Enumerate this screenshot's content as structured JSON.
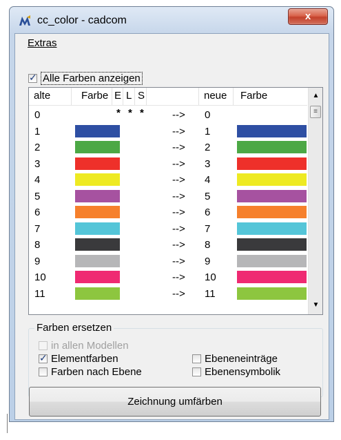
{
  "window": {
    "title": "cc_color - cadcom",
    "close_glyph": "x"
  },
  "menu": {
    "extras_label": "Extras"
  },
  "show_all": {
    "label": "Alle Farben anzeigen",
    "checked": true
  },
  "table": {
    "headers": {
      "old": "alte",
      "color_old": "Farbe",
      "e": "E",
      "l": "L",
      "s": "S",
      "new": "neue",
      "color_new": "Farbe"
    },
    "rows": [
      {
        "old": "0",
        "e": "*",
        "l": "*",
        "s": "*",
        "arrow": "-->",
        "new": "0",
        "color": "#ffffff"
      },
      {
        "old": "1",
        "arrow": "-->",
        "new": "1",
        "color": "#2e4fa3"
      },
      {
        "old": "2",
        "arrow": "-->",
        "new": "2",
        "color": "#4ca845"
      },
      {
        "old": "3",
        "arrow": "-->",
        "new": "3",
        "color": "#ee302a"
      },
      {
        "old": "4",
        "arrow": "-->",
        "new": "4",
        "color": "#eeea22"
      },
      {
        "old": "5",
        "arrow": "-->",
        "new": "5",
        "color": "#a652a0"
      },
      {
        "old": "6",
        "arrow": "-->",
        "new": "6",
        "color": "#f6802c"
      },
      {
        "old": "7",
        "arrow": "-->",
        "new": "7",
        "color": "#54c5d8"
      },
      {
        "old": "8",
        "arrow": "-->",
        "new": "8",
        "color": "#3a3a3c"
      },
      {
        "old": "9",
        "arrow": "-->",
        "new": "9",
        "color": "#b6b6b8"
      },
      {
        "old": "10",
        "arrow": "-->",
        "new": "10",
        "color": "#ef2a72"
      },
      {
        "old": "11",
        "arrow": "-->",
        "new": "11",
        "color": "#8dc63f"
      }
    ]
  },
  "replace_group": {
    "title": "Farben ersetzen",
    "all_models": {
      "label": "in allen Modellen",
      "checked": false,
      "disabled": true
    },
    "element_colors": {
      "label": "Elementfarben",
      "checked": true
    },
    "colors_by_level": {
      "label": "Farben nach Ebene",
      "checked": false
    },
    "level_entries": {
      "label": "Ebeneneinträge",
      "checked": false
    },
    "level_symbology": {
      "label": "Ebenensymbolik",
      "checked": false
    }
  },
  "action_button": {
    "label": "Zeichnung umfärben"
  }
}
